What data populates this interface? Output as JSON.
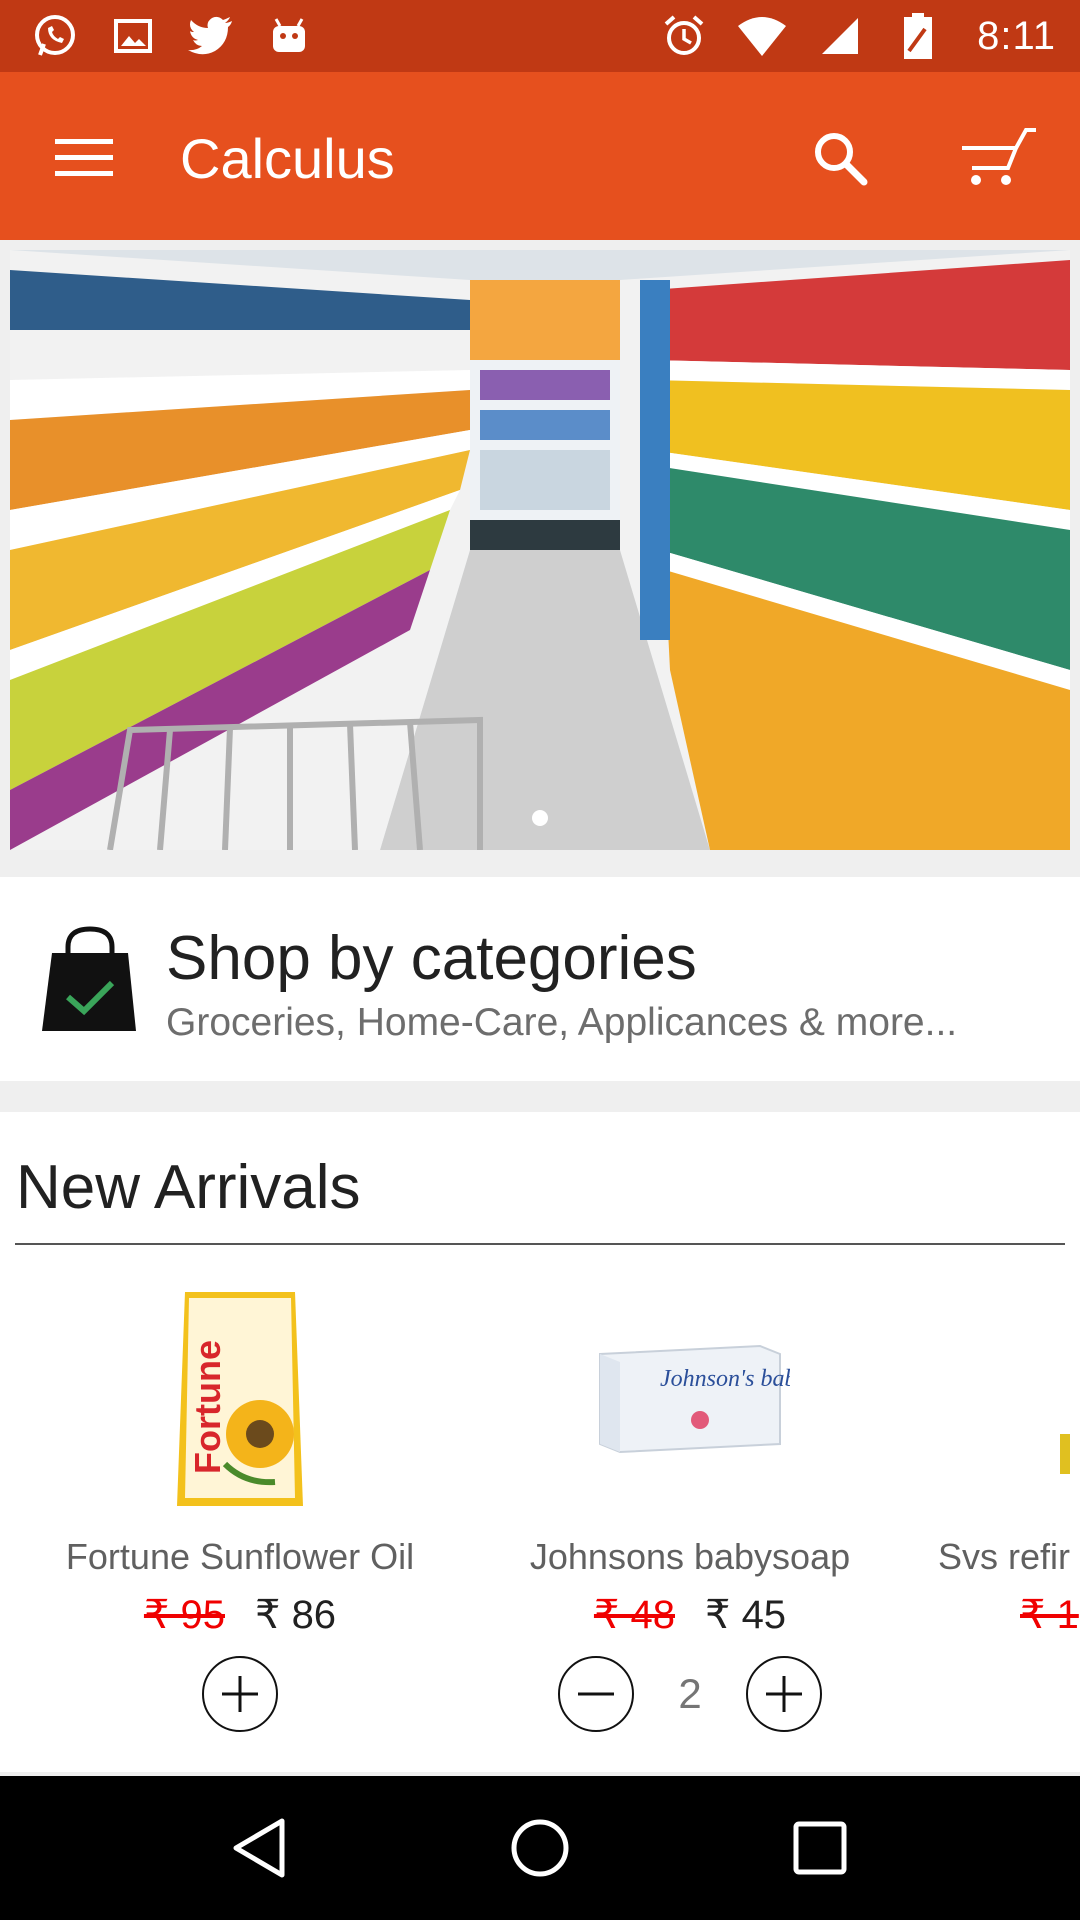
{
  "status_bar": {
    "time": "8:11",
    "left_icons": [
      "whatsapp-icon",
      "gallery-icon",
      "twitter-icon",
      "android-icon"
    ],
    "right_icons": [
      "alarm-icon",
      "wifi-icon",
      "signal-icon",
      "battery-icon"
    ]
  },
  "app_bar": {
    "title": "Calculus",
    "bg_color": "#e6501e"
  },
  "banner": {
    "page_count": 1,
    "active_page": 1
  },
  "categories": {
    "title": "Shop by categories",
    "subtitle": "Groceries, Home-Care, Applicances & more..."
  },
  "new_arrivals": {
    "title": "New Arrivals",
    "products": [
      {
        "name": "Fortune  Sunflower Oil",
        "old_price": "₹ 95",
        "price": "₹ 86",
        "quantity": null,
        "brand_text": "Fortune"
      },
      {
        "name": "Johnsons babysoap",
        "old_price": "₹ 48",
        "price": "₹ 45",
        "quantity": "2",
        "brand_text": "Johnson's baby soap"
      },
      {
        "name": "Svs refir",
        "old_price": "₹ 1",
        "price": "",
        "quantity": null
      }
    ]
  },
  "colors": {
    "status_bar": "#c03914",
    "accent": "#e6501e",
    "old_price": "#f00000"
  }
}
